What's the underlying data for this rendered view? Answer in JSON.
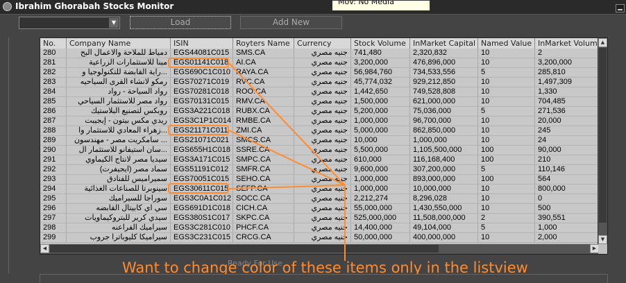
{
  "window": {
    "title": "Ibrahim Ghorabah Stocks Monitor",
    "tooltip": "Mov: No Media"
  },
  "toolbar": {
    "combo_value": "",
    "load_label": "Load",
    "add_label": "Add New"
  },
  "list": {
    "columns": [
      "No.",
      "Company Name",
      "ISIN",
      "Royters Name",
      "Currency",
      "Stock Volume",
      "InMarket Capital",
      "Named Value",
      "InMarket Volume"
    ],
    "rows": [
      [
        "280",
        "دمياط للملاحة والاعمال البح",
        "EGS44081C015",
        "SMS.CA",
        "جنيه مصري",
        "741,480",
        "2,320,832",
        "10",
        "2"
      ],
      [
        "281",
        "مينا للاستثمارات الزراعية",
        "EGS01141C018",
        "AI.CA",
        "جنيه مصري",
        "3,200,000",
        "476,896,000",
        "10",
        "3,200,000"
      ],
      [
        "282",
        "...راية القابضة للتكنولوجيا و",
        "EGS690C1C010",
        "RAYA.CA",
        "جنيه مصري",
        "56,984,760",
        "734,533,556",
        "5",
        "285,810"
      ],
      [
        "283",
        "رمكو لانشاء القرى السياحيه",
        "EGS70271C019",
        "RVC.CA",
        "جنيه مصري",
        "45,774,032",
        "929,212,850",
        "10",
        "1,497,309"
      ],
      [
        "284",
        "رواد السياحة - رواد",
        "EGS70281C018",
        "ROO.CA",
        "جنيه مصري",
        "1,442,650",
        "749,528,808",
        "10",
        "1,330"
      ],
      [
        "285",
        "رواد مصر للاستثمار السياحي",
        "EGS70131C015",
        "RMV.CA",
        "جنيه مصري",
        "1,500,000",
        "621,000,000",
        "10",
        "704,485"
      ],
      [
        "286",
        "روبكس لتصنيع البلاستيك",
        "EGS3A221C018",
        "RUBX.CA",
        "جنيه مصري",
        "5,200,000",
        "75,036,000",
        "5",
        "271,536"
      ],
      [
        "287",
        "ريدي مكس بيتون - إيجيبت",
        "EGS3C1P1C014",
        "RMBE.CA",
        "جنيه مصري",
        "1,000,000",
        "96,700,000",
        "10",
        "20,000"
      ],
      [
        "288",
        "...زهراء المعادي للاستثمار وا",
        "EGS21171C011",
        "ZMI.CA",
        "جنيه مصري",
        "5,000,000",
        "862,850,000",
        "10",
        "245"
      ],
      [
        "289",
        "... سامكريت مصر - مهندسون",
        "EGS21071C021",
        "SMCS.CA",
        "جنيه مصري",
        "10,000",
        "1,000,000",
        "10",
        "24"
      ],
      [
        "290",
        "...سان استيفانو للاستثمار ال",
        "EGS655H1C018",
        "SSRE.CA",
        "جنيه مصري",
        "5,500,000",
        "1,105,500,000",
        "100",
        "90,000"
      ],
      [
        "291",
        "سيديا مصر لانتاج الكيماوي",
        "EGS3A171C015",
        "SMPC.CA",
        "جنيه مصري",
        "610,000",
        "116,168,400",
        "100",
        "210"
      ],
      [
        "292",
        "سماد مصر (ايجيفرت)",
        "EGS51191C012",
        "SMFR.CA",
        "جنيه مصري",
        "9,600,000",
        "307,200,000",
        "5",
        "110,146"
      ],
      [
        "293",
        "سميراميس للفنادق",
        "EGS70051C015",
        "SEHO.CA",
        "جنيه مصري",
        "1,000,000",
        "893,000,000",
        "100",
        "564"
      ],
      [
        "294",
        "سينوبرتا للصناعات الغذائية",
        "EGS30611C015",
        "SEFP.CA",
        "جنيه مصري",
        "1,000,000",
        "10,000,000",
        "10",
        "800,000"
      ],
      [
        "295",
        "سوراجا للسيراميك",
        "EGS3C0A1C012",
        "SOCC.CA",
        "جنيه مصري",
        "2,212,274",
        "8,296,028",
        "10",
        "0"
      ],
      [
        "296",
        "سي اي كابيتال القابضه",
        "EGS691D1C018",
        "CICH.CA",
        "جنيه مصري",
        "55,000,000",
        "1,430,550,000",
        "10",
        "500"
      ],
      [
        "297",
        "سيدي كرير للبتروكيماويات",
        "EGS380S1C017",
        "SKPC.CA",
        "جنيه مصري",
        "525,000,000",
        "11,508,000,000",
        "2",
        "390,551"
      ],
      [
        "298",
        "سيراميك الفراعنه",
        "EGS3C281C010",
        "PHCF.CA",
        "جنيه مصري",
        "14,400,000",
        "49,104,000",
        "5",
        "1,000"
      ],
      [
        "299",
        "سيراميكا كليوباترا جروب",
        "EGS3C231C015",
        "CRCG.CA",
        "جنيه مصري",
        "50,000,000",
        "400,000,000",
        "10",
        "2,000"
      ]
    ]
  },
  "status_text": "Ready For Use",
  "annotation_text": "Want to change color of these items only in the listview",
  "colors": {
    "annotation": "#ff8c30",
    "list_bg": "#c8c8c8",
    "window_bg": "#444444"
  }
}
